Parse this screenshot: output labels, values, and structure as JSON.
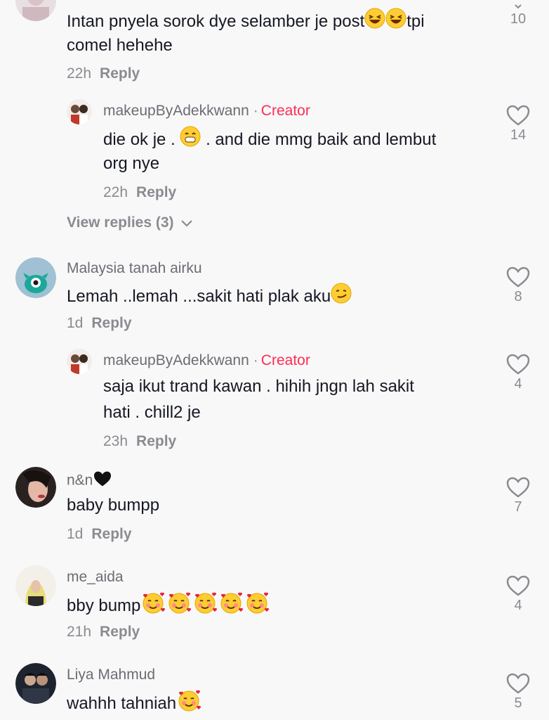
{
  "comments": [
    {
      "text_line1": "Intan pnyela sorok dye selamber je post",
      "text_after": "tpi",
      "text_line2": "comel hehehe",
      "time": "22h",
      "reply_label": "Reply",
      "likes": "10",
      "emoji": [
        "laughing-emoji",
        "laughing-emoji"
      ]
    },
    {
      "username": "makeupByAdekkwann",
      "dot": "·",
      "badge": "Creator",
      "text_line1a": "die ok je .",
      "text_line1b": ". and die mmg baik and lembut",
      "text_line2": "org nye",
      "time": "22h",
      "reply_label": "Reply",
      "likes": "14",
      "emoji": [
        "grin-emoji"
      ]
    },
    {
      "username": "Malaysia tanah airku",
      "text_line1": "Lemah ..lemah ...sakit hati plak aku",
      "time": "1d",
      "reply_label": "Reply",
      "likes": "8",
      "emoji": [
        "smirk-emoji"
      ]
    },
    {
      "username": "makeupByAdekkwann",
      "dot": "·",
      "badge": "Creator",
      "text_line1": "saja ikut trand kawan . hihih jngn lah sakit",
      "text_line2": "hati . chill2 je",
      "time": "23h",
      "reply_label": "Reply",
      "likes": "4"
    },
    {
      "username": "n&n",
      "text_line1": "baby bumpp",
      "time": "1d",
      "reply_label": "Reply",
      "likes": "7",
      "emoji": [
        "black-heart-emoji"
      ]
    },
    {
      "username": "me_aida",
      "text_line1": "bby bump",
      "time": "21h",
      "reply_label": "Reply",
      "likes": "4",
      "emoji": [
        "smiling-hearts-emoji",
        "smiling-hearts-emoji",
        "smiling-hearts-emoji",
        "smiling-hearts-emoji",
        "smiling-hearts-emoji"
      ]
    },
    {
      "username": "Liya Mahmud",
      "text_line1": "wahhh tahniah",
      "likes": "5",
      "emoji": [
        "smiling-hearts-emoji"
      ]
    }
  ],
  "view_replies": "View replies (3)",
  "colors": {
    "creator": "#fe2c55",
    "meta": "#8a8b91",
    "text": "#161823",
    "background": "#f8f8f8"
  }
}
